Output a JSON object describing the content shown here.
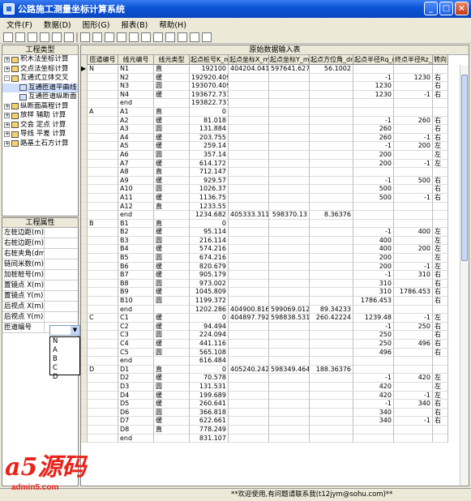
{
  "window": {
    "title": "公路施工测量坐标计算系统"
  },
  "menu": [
    "文件(F)",
    "数据(D)",
    "图形(G)",
    "报表(B)",
    "帮助(H)"
  ],
  "left": {
    "types_title": "工程类型",
    "tree": [
      {
        "label": "积木法坐标计算",
        "indent": 0,
        "exp": "+",
        "icon": "folder"
      },
      {
        "label": "交点法坐标计算",
        "indent": 0,
        "exp": "+",
        "icon": "folder"
      },
      {
        "label": "互通式立体交叉",
        "indent": 0,
        "exp": "-",
        "icon": "folder"
      },
      {
        "label": "互通匝道平曲线",
        "indent": 1,
        "exp": "",
        "icon": "doc"
      },
      {
        "label": "互通匝道纵断面",
        "indent": 1,
        "exp": "",
        "icon": "doc"
      },
      {
        "label": "纵断面高程计算",
        "indent": 0,
        "exp": "+",
        "icon": "folder"
      },
      {
        "label": "放样 辅助 计算",
        "indent": 0,
        "exp": "+",
        "icon": "folder"
      },
      {
        "label": "交会 定点 计算",
        "indent": 0,
        "exp": "+",
        "icon": "folder"
      },
      {
        "label": "导线 平差 计算",
        "indent": 0,
        "exp": "+",
        "icon": "folder"
      },
      {
        "label": "路基土石方计算",
        "indent": 0,
        "exp": "+",
        "icon": "folder"
      }
    ],
    "props_title": "工程属性",
    "props": [
      "左桩边距(m)",
      "右桩边距(m)",
      "右桩夹角(dms)",
      "链间米数(m)",
      "加桩桩号(m)",
      "置镜点 X(m)",
      "置镜点 Y(m)",
      "后视点 X(m)",
      "后视点 Y(m)",
      "匝道编号"
    ],
    "drop_options": [
      "N",
      "A",
      "B",
      "C",
      "D"
    ]
  },
  "table": {
    "title": "原始数据输入表",
    "headers": [
      "匝道编号",
      "线元编号",
      "线元类型",
      "起点桩号K_m",
      "起点坐标X_m",
      "起点坐标Y_m",
      "起点方位角_dms",
      "起点半径Rq_m",
      "终点半径Rz_m",
      "转向"
    ],
    "rows": [
      [
        "N",
        "N1",
        "直",
        "192100",
        "404204.041",
        "597641.627",
        "56.1002",
        "",
        "",
        ""
      ],
      [
        "",
        "N2",
        "缓",
        "192920.409",
        "",
        "",
        "",
        "-1",
        "1230",
        "右"
      ],
      [
        "",
        "N3",
        "圆",
        "193070.409",
        "",
        "",
        "",
        "1230",
        "",
        "右"
      ],
      [
        "",
        "N4",
        "缓",
        "193672.731",
        "",
        "",
        "",
        "1230",
        "-1",
        "右"
      ],
      [
        "",
        "end",
        "",
        "193822.731",
        "",
        "",
        "",
        "",
        "",
        ""
      ],
      [
        "A",
        "A1",
        "直",
        "0",
        "",
        "",
        "",
        "",
        "",
        ""
      ],
      [
        "",
        "A2",
        "缓",
        "81.018",
        "",
        "",
        "",
        "-1",
        "260",
        "右"
      ],
      [
        "",
        "A3",
        "圆",
        "131.884",
        "",
        "",
        "",
        "260",
        "",
        "右"
      ],
      [
        "",
        "A4",
        "缓",
        "203.755",
        "",
        "",
        "",
        "260",
        "-1",
        "右"
      ],
      [
        "",
        "A5",
        "缓",
        "259.14",
        "",
        "",
        "",
        "-1",
        "200",
        "左"
      ],
      [
        "",
        "A6",
        "圆",
        "357.14",
        "",
        "",
        "",
        "200",
        "",
        "左"
      ],
      [
        "",
        "A7",
        "缓",
        "614.172",
        "",
        "",
        "",
        "200",
        "-1",
        "左"
      ],
      [
        "",
        "A8",
        "直",
        "712.147",
        "",
        "",
        "",
        "",
        "",
        ""
      ],
      [
        "",
        "A9",
        "缓",
        "929.57",
        "",
        "",
        "",
        "-1",
        "500",
        "右"
      ],
      [
        "",
        "A10",
        "圆",
        "1026.37",
        "",
        "",
        "",
        "500",
        "",
        "右"
      ],
      [
        "",
        "A11",
        "缓",
        "1136.75",
        "",
        "",
        "",
        "500",
        "-1",
        "右"
      ],
      [
        "",
        "A12",
        "直",
        "1233.55",
        "",
        "",
        "",
        "",
        "",
        ""
      ],
      [
        "",
        "end",
        "",
        "1234.682",
        "405333.311",
        "598370.13",
        "8.36376",
        "",
        "",
        ""
      ],
      [
        "B",
        "B1",
        "直",
        "0",
        "",
        "",
        "",
        "",
        "",
        ""
      ],
      [
        "",
        "B2",
        "缓",
        "95.114",
        "",
        "",
        "",
        "-1",
        "400",
        "左"
      ],
      [
        "",
        "B3",
        "圆",
        "216.114",
        "",
        "",
        "",
        "400",
        "",
        "左"
      ],
      [
        "",
        "B4",
        "缓",
        "574.216",
        "",
        "",
        "",
        "400",
        "200",
        "左"
      ],
      [
        "",
        "B5",
        "圆",
        "674.216",
        "",
        "",
        "",
        "200",
        "",
        "左"
      ],
      [
        "",
        "B6",
        "缓",
        "820.679",
        "",
        "",
        "",
        "200",
        "-1",
        "左"
      ],
      [
        "",
        "B7",
        "缓",
        "905.179",
        "",
        "",
        "",
        "-1",
        "310",
        "右"
      ],
      [
        "",
        "B8",
        "圆",
        "973.002",
        "",
        "",
        "",
        "310",
        "",
        "右"
      ],
      [
        "",
        "B9",
        "缓",
        "1045.809",
        "",
        "",
        "",
        "310",
        "1786.453",
        "右"
      ],
      [
        "",
        "B10",
        "圆",
        "1199.372",
        "",
        "",
        "",
        "1786.453",
        "",
        "右"
      ],
      [
        "",
        "end",
        "",
        "1202.286",
        "404900.816",
        "599069.012",
        "89.34233",
        "",
        "",
        ""
      ],
      [
        "C",
        "C1",
        "缓",
        "0",
        "404897.792",
        "598838.531",
        "260.42224",
        "1239.48",
        "-1",
        "左"
      ],
      [
        "",
        "C2",
        "缓",
        "94.494",
        "",
        "",
        "",
        "-1",
        "250",
        "右"
      ],
      [
        "",
        "C3",
        "圆",
        "224.094",
        "",
        "",
        "",
        "250",
        "",
        "右"
      ],
      [
        "",
        "C4",
        "缓",
        "441.116",
        "",
        "",
        "",
        "250",
        "496",
        "右"
      ],
      [
        "",
        "C5",
        "圆",
        "565.108",
        "",
        "",
        "",
        "496",
        "",
        "右"
      ],
      [
        "",
        "end",
        "",
        "616.484",
        "",
        "",
        "",
        "",
        "",
        ""
      ],
      [
        "D",
        "D1",
        "直",
        "0",
        "405240.242",
        "598349.464",
        "188.36376",
        "",
        "",
        ""
      ],
      [
        "",
        "D2",
        "缓",
        "70.578",
        "",
        "",
        "",
        "-1",
        "420",
        "左"
      ],
      [
        "",
        "D3",
        "圆",
        "131.531",
        "",
        "",
        "",
        "420",
        "",
        "左"
      ],
      [
        "",
        "D4",
        "缓",
        "199.689",
        "",
        "",
        "",
        "420",
        "-1",
        "左"
      ],
      [
        "",
        "D5",
        "缓",
        "260.641",
        "",
        "",
        "",
        "-1",
        "340",
        "右"
      ],
      [
        "",
        "D6",
        "圆",
        "366.818",
        "",
        "",
        "",
        "340",
        "",
        "右"
      ],
      [
        "",
        "D7",
        "缓",
        "622.661",
        "",
        "",
        "",
        "340",
        "-1",
        "右"
      ],
      [
        "",
        "D8",
        "直",
        "778.249",
        "",
        "",
        "",
        "",
        "",
        ""
      ],
      [
        "",
        "end",
        "",
        "831.107",
        "",
        "",
        "",
        "",
        "",
        ""
      ]
    ]
  },
  "status": "**欢迎使用,有问题请联系我(t12jym@sohu.com)**",
  "watermark": {
    "mark": "a5源码",
    "site": "admin5.com"
  }
}
